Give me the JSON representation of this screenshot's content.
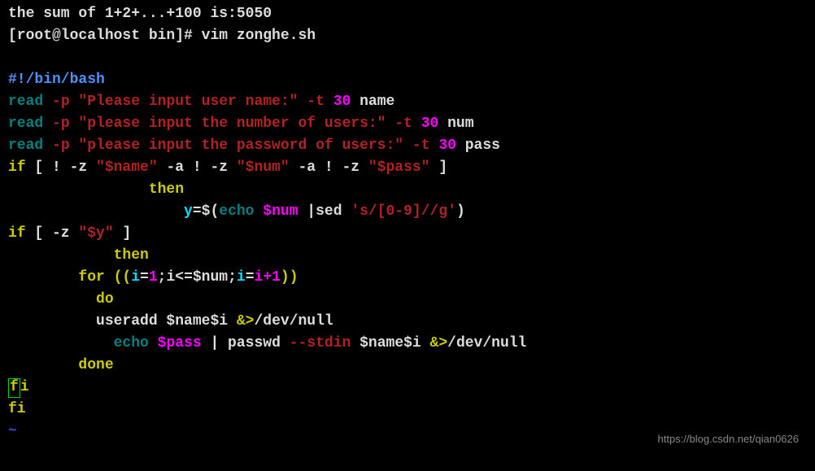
{
  "terminal": {
    "top_partial": "the sum of 1+2+...+100 is:5050",
    "prompt": "[root@localhost bin]# vim zonghe.sh",
    "shebang": "#!/bin/bash",
    "read1_cmd": "read ",
    "read1_opt": "-p ",
    "read1_str": "\"Please input user name:\"",
    "read1_t": " -t ",
    "read1_num": "30",
    "read1_var": " name",
    "read2_cmd": "read ",
    "read2_opt": "-p ",
    "read2_str": "\"please input the number of users:\"",
    "read2_t": " -t ",
    "read2_num": "30",
    "read2_var": " num",
    "read3_cmd": "read ",
    "read3_opt": "-p ",
    "read3_str": "\"please input the password of users:\"",
    "read3_t": " -t ",
    "read3_num": "30",
    "read3_var": " pass",
    "if1_a": "if ",
    "if1_b": "[ ! -z ",
    "if1_c": "\"$name\"",
    "if1_d": " -a ! -z ",
    "if1_e": "\"$num\"",
    "if1_f": " -a ! -z ",
    "if1_g": "\"$pass\"",
    "if1_h": " ]",
    "then1": "                then",
    "y_assign_a": "                    ",
    "y_assign_b": "y",
    "y_assign_c": "=$(",
    "y_assign_d": "echo",
    "y_assign_e": " $num ",
    "y_assign_f": "|sed ",
    "y_assign_g": "'s/[0-9]//g'",
    "y_assign_h": ")",
    "if2_a": "if ",
    "if2_b": "[ -z ",
    "if2_c": "\"$y\"",
    "if2_d": " ]",
    "then2": "            then",
    "for_a": "        for ",
    "for_b": "((",
    "for_c": "i",
    "for_d": "=",
    "for_e": "1",
    "for_f": ";i<=$num;",
    "for_g": "i",
    "for_h": "=",
    "for_i": "i+1",
    "for_j": "))",
    "do": "          do",
    "ua_a": "          useradd $name$i ",
    "ua_b": "&>",
    "ua_c": "/dev/null",
    "echo_a": "            echo ",
    "echo_b": "$pass",
    "echo_c": " | passwd ",
    "echo_d": "--stdin ",
    "echo_e": "$name$i ",
    "echo_f": "&>",
    "echo_g": "/dev/null",
    "done": "        done",
    "fi1_f": "f",
    "fi1_i": "i",
    "fi2": "fi",
    "tilde": "~",
    "watermark": "https://blog.csdn.net/qian0626"
  }
}
